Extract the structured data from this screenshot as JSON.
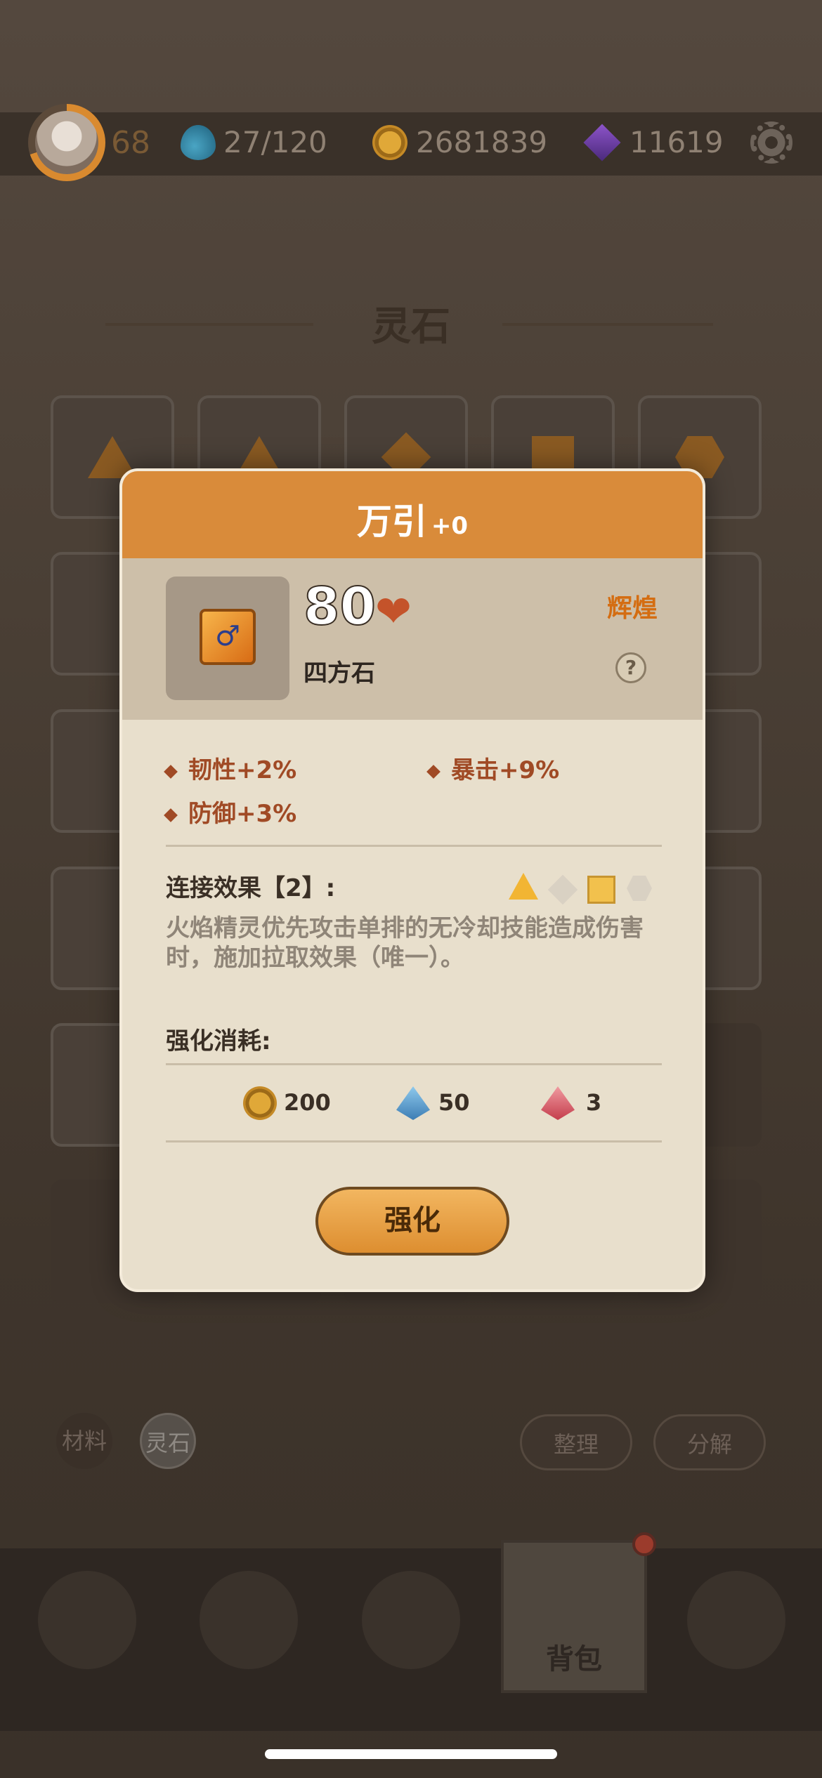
{
  "player": {
    "level": "68"
  },
  "resources": {
    "stamina": "27/120",
    "gold": "2681839",
    "gems": "11619"
  },
  "section": {
    "title": "灵石"
  },
  "filters": {
    "materials": "材料",
    "stones": "灵石"
  },
  "actions": {
    "sort": "整理",
    "decompose": "分解"
  },
  "nav": {
    "bag_label": "背包"
  },
  "modal": {
    "title": "万引",
    "level": "+0",
    "power": "80",
    "stone_type": "四方石",
    "rarity": "辉煌",
    "help": "?",
    "attributes": [
      "韧性+2%",
      "暴击+9%",
      "防御+3%"
    ],
    "link_label": "连接效果【2】:",
    "link_desc": "火焰精灵优先攻击单排的无冷却技能造成伤害时，施加拉取效果（唯一）。",
    "cost_label": "强化消耗:",
    "costs": {
      "gold": "200",
      "blue": "50",
      "red": "3"
    },
    "enhance_button": "强化"
  },
  "colors": {
    "header": "#d98b3a",
    "rarity": "#d46d12",
    "attr": "#a04a25"
  },
  "icons": {
    "avatar": "avatar-icon",
    "stamina": "water-drop-icon",
    "gold": "coin-icon",
    "gems": "purple-gem-icon",
    "settings": "gear-icon",
    "heart": "heart-icon",
    "help": "question-icon"
  }
}
